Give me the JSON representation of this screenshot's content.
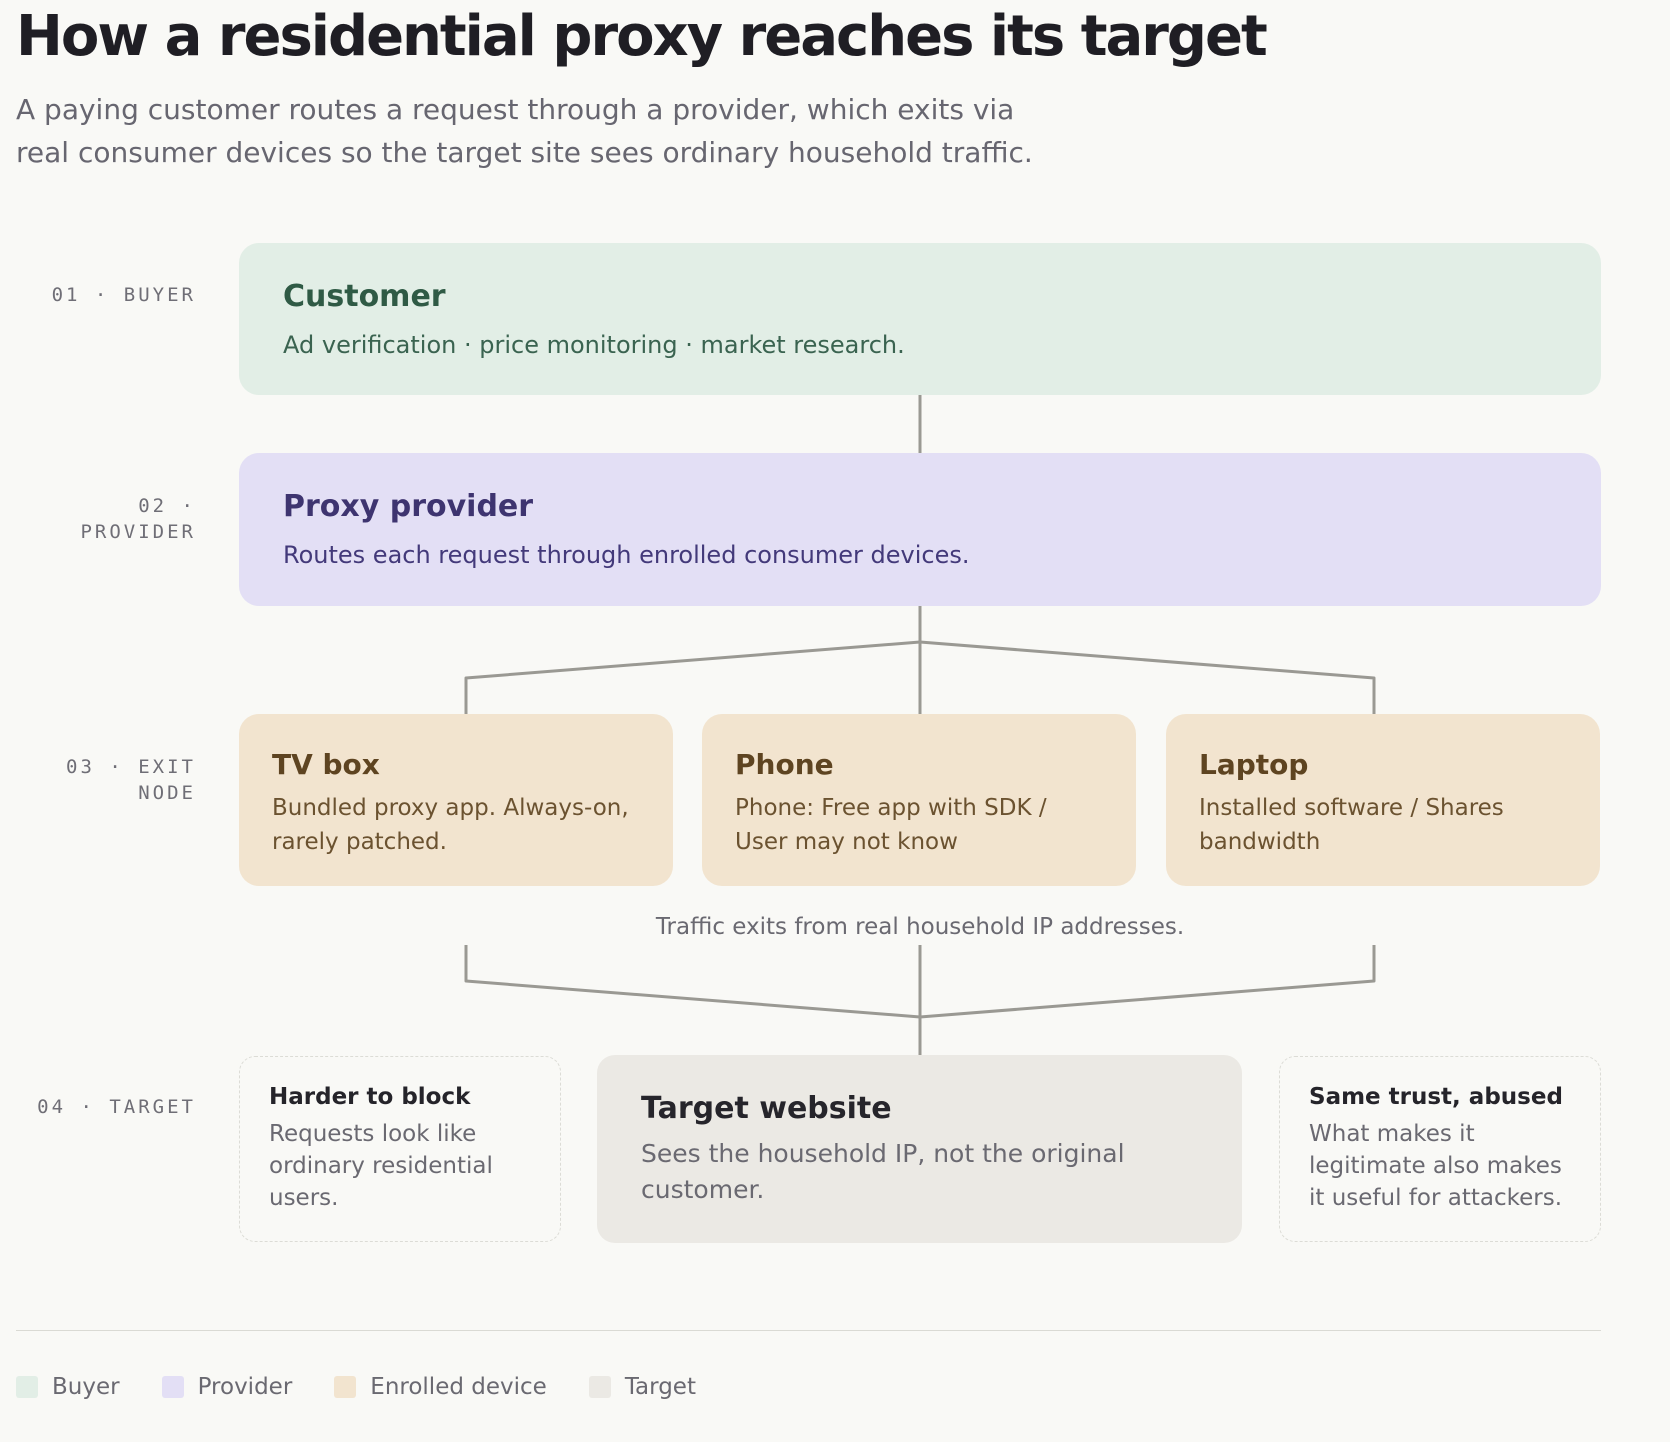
{
  "title": "How a residential proxy reaches its target",
  "subtitle": "A paying customer routes a request through a provider, which exits via real consumer devices so the target site sees ordinary household traffic.",
  "stages": [
    {
      "label": "01 · BUYER"
    },
    {
      "label": "02 · PROVIDER"
    },
    {
      "label": "03 · EXIT NODE"
    },
    {
      "label": "04 · TARGET"
    }
  ],
  "customer": {
    "title": "Customer",
    "description": "Ad verification · price monitoring · market research."
  },
  "provider": {
    "title": "Proxy provider",
    "description": "Routes each request through enrolled consumer devices."
  },
  "devices": [
    {
      "title": "TV box",
      "description": "Bundled proxy app. Always-on, rarely patched."
    },
    {
      "title": "Phone",
      "description": "Phone: Free app with SDK / User may not know"
    },
    {
      "title": "Laptop",
      "description": "Installed software / Shares bandwidth"
    }
  ],
  "exit_caption": "Traffic exits from real household IP addresses.",
  "target": {
    "title": "Target website",
    "description": "Sees the household IP, not the original customer."
  },
  "notes": {
    "left": {
      "title": "Harder to block",
      "description": "Requests look like ordinary residential users."
    },
    "right": {
      "title": "Same trust, abused",
      "description": "What makes it legitimate also makes it useful for attackers."
    }
  },
  "legend": [
    {
      "label": "Buyer",
      "color": "#e2eee6"
    },
    {
      "label": "Provider",
      "color": "#e3dff5"
    },
    {
      "label": "Enrolled device",
      "color": "#f2e4cf"
    },
    {
      "label": "Target",
      "color": "#ebe9e4"
    }
  ],
  "colors": {
    "connector": "#9a9993",
    "background": "#f9f9f6"
  }
}
